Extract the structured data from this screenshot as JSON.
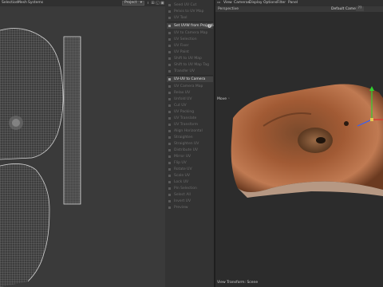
{
  "uv_window": {
    "menu": [
      "Selection",
      "Mesh",
      "Systems"
    ],
    "project_select": "Project",
    "project_chevron_icon": "chevron-down-icon",
    "tools": [
      "lock-icon",
      "grid-icon",
      "frame-icon",
      "view-icon"
    ]
  },
  "middle_panel": {
    "items": [
      {
        "label": "Seed UV Cut",
        "state": "dim",
        "icon": "uv-icon"
      },
      {
        "label": "Pelvis to UV Map",
        "state": "dim",
        "icon": "uv-icon"
      },
      {
        "label": "UV Tool",
        "state": "dim",
        "icon": "uv-icon"
      },
      {
        "label": "Set UVW from Projection",
        "state": "active",
        "icon": "projection-icon",
        "badge": "?"
      },
      {
        "label": "UV to Camera Map",
        "state": "dim",
        "icon": "uv-icon"
      },
      {
        "label": "UV Selection",
        "state": "dim",
        "icon": "uv-icon"
      },
      {
        "label": "UV Fixer",
        "state": "dim",
        "icon": "uv-icon"
      },
      {
        "label": "UV Paint",
        "state": "dim",
        "icon": "uv-icon"
      },
      {
        "label": "Shift to UV Map",
        "state": "dim",
        "icon": "uv-icon"
      },
      {
        "label": "Shift to UV Map Tag",
        "state": "dim",
        "icon": "uv-icon"
      },
      {
        "label": "Transfer UV",
        "state": "dim",
        "icon": "uv-icon"
      },
      {
        "label": "UV-UV to Camera",
        "state": "active",
        "icon": "camera-icon"
      },
      {
        "label": "UV Camera Map",
        "state": "dim",
        "icon": "uv-icon"
      },
      {
        "label": "Relax UV",
        "state": "dim",
        "icon": "uv-icon"
      },
      {
        "label": "Unfold UV",
        "state": "dim",
        "icon": "uv-icon"
      },
      {
        "label": "Cut UV",
        "state": "dim",
        "icon": "uv-icon"
      },
      {
        "label": "UV Packing",
        "state": "dim",
        "icon": "uv-icon"
      },
      {
        "label": "UV Translate",
        "state": "dim",
        "icon": "uv-icon"
      },
      {
        "label": "UV Transform",
        "state": "dim",
        "icon": "uv-icon"
      },
      {
        "label": "Align Horizontal",
        "state": "dim",
        "icon": "uv-icon"
      },
      {
        "label": "Straighten",
        "state": "dim",
        "icon": "uv-icon"
      },
      {
        "label": "Straighten UV",
        "state": "dim",
        "icon": "uv-icon"
      },
      {
        "label": "Distribute UV",
        "state": "dim",
        "icon": "uv-icon"
      },
      {
        "label": "Mirror UV",
        "state": "dim",
        "icon": "uv-icon"
      },
      {
        "label": "Flip UV",
        "state": "dim",
        "icon": "uv-icon"
      },
      {
        "label": "Rotate UV",
        "state": "dim",
        "icon": "uv-icon"
      },
      {
        "label": "Scale UV",
        "state": "dim",
        "icon": "uv-icon"
      },
      {
        "label": "Lock UV",
        "state": "dim",
        "icon": "uv-icon"
      },
      {
        "label": "Pin Selection",
        "state": "dim",
        "icon": "uv-icon"
      },
      {
        "label": "Select All",
        "state": "dim",
        "icon": "uv-icon"
      },
      {
        "label": "Invert UV",
        "state": "dim",
        "icon": "uv-icon"
      },
      {
        "label": "Preview",
        "state": "dim",
        "icon": "uv-icon"
      }
    ]
  },
  "viewport": {
    "menu": [
      "View",
      "Cameras",
      "Display",
      "Options",
      "Filter",
      "Panel"
    ],
    "view_name": "Perspective",
    "camera_label": "Default Camera",
    "camera_badge": "??",
    "mode_label": "Move",
    "mode_icon": "move-icon",
    "status": "View Transform: Scene",
    "axis_colors": {
      "x": "#e03030",
      "y": "#30d030",
      "z": "#3060ff"
    }
  }
}
